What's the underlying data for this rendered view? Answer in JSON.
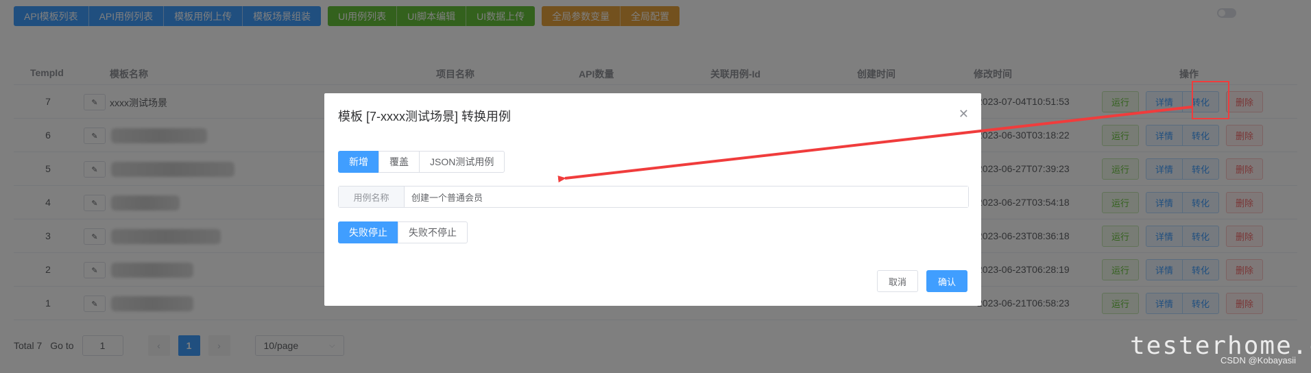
{
  "toolbar": {
    "blue": [
      "API模板列表",
      "API用例列表",
      "模板用例上传",
      "模板场景组装"
    ],
    "green": [
      "UI用例列表",
      "UI脚本编辑",
      "UI数据上传"
    ],
    "orange": [
      "全局参数变量",
      "全局配置"
    ]
  },
  "table": {
    "headers": {
      "id": "TempId",
      "name": "模板名称",
      "project": "项目名称",
      "api_count": "API数量",
      "case_id": "关联用例-Id",
      "created": "创建时间",
      "modified": "修改时间",
      "ops": "操作"
    },
    "rows": [
      {
        "id": "7",
        "name": "xxxx测试场景",
        "modified": "2023-07-04T10:51:53"
      },
      {
        "id": "6",
        "name": "",
        "modified": "2023-06-30T03:18:22"
      },
      {
        "id": "5",
        "name": "",
        "modified": "2023-06-27T07:39:23"
      },
      {
        "id": "4",
        "name": "",
        "modified": "2023-06-27T03:54:18"
      },
      {
        "id": "3",
        "name": "",
        "modified": "2023-06-23T08:36:18"
      },
      {
        "id": "2",
        "name": "",
        "modified": "2023-06-23T06:28:19"
      },
      {
        "id": "1",
        "name": "",
        "modified": "2023-06-21T06:58:23"
      }
    ],
    "actions": {
      "run": "运行",
      "detail": "详情",
      "convert": "转化",
      "delete": "删除"
    }
  },
  "pagination": {
    "total": "Total 7",
    "goto_label": "Go to",
    "goto_value": "1",
    "current": "1",
    "prev": "‹",
    "next": "›",
    "page_size": "10/page"
  },
  "modal": {
    "title": "模板 [7-xxxx测试场景] 转换用例",
    "tabs": [
      "新增",
      "覆盖",
      "JSON测试用例"
    ],
    "field_label": "用例名称",
    "field_value": "创建一个普通会员",
    "stop_options": [
      "失败停止",
      "失败不停止"
    ],
    "cancel": "取消",
    "confirm": "确认"
  },
  "watermark": {
    "brand": "testerhome.com",
    "credit": "CSDN @Kobayasii"
  }
}
